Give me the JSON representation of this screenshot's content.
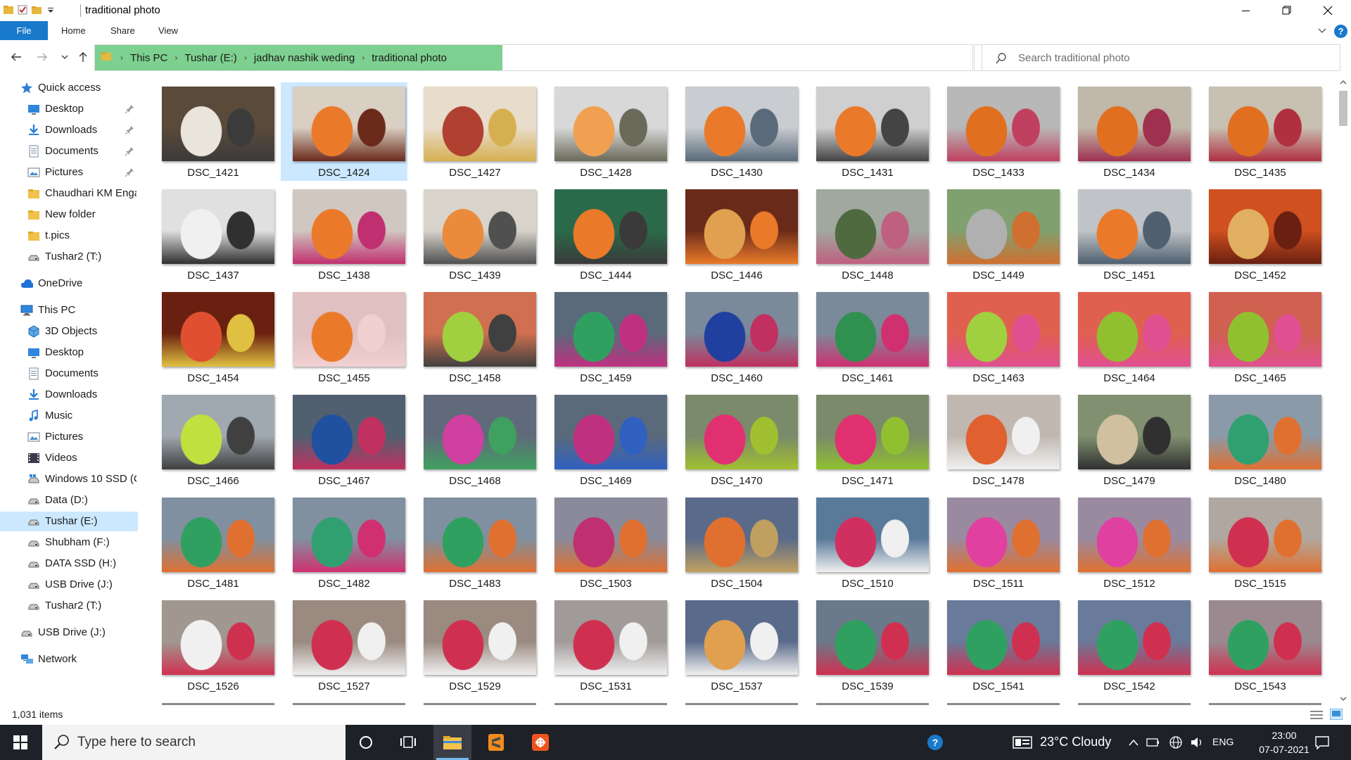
{
  "window": {
    "title": "traditional photo",
    "controls": {
      "minimize": "minimize",
      "maximize": "restore",
      "close": "close"
    }
  },
  "ribbon": {
    "tabs": [
      {
        "label": "File",
        "active": true
      },
      {
        "label": "Home"
      },
      {
        "label": "Share"
      },
      {
        "label": "View"
      }
    ]
  },
  "address": {
    "crumbs": [
      "This PC",
      "Tushar (E:)",
      "jadhav nashik weding",
      "traditional photo"
    ],
    "highlight_color": "#7dd08f"
  },
  "search": {
    "placeholder": "Search traditional photo"
  },
  "sidebar": {
    "items": [
      {
        "label": "Quick access",
        "icon": "star-icon",
        "indent": 1
      },
      {
        "label": "Desktop",
        "icon": "desktop-icon",
        "indent": 2,
        "pinned": true
      },
      {
        "label": "Downloads",
        "icon": "download-icon",
        "indent": 2,
        "pinned": true
      },
      {
        "label": "Documents",
        "icon": "document-icon",
        "indent": 2,
        "pinned": true
      },
      {
        "label": "Pictures",
        "icon": "pictures-icon",
        "indent": 2,
        "pinned": true
      },
      {
        "label": "Chaudhari KM Enga",
        "icon": "folder-icon",
        "indent": 2
      },
      {
        "label": "New folder",
        "icon": "folder-icon",
        "indent": 2
      },
      {
        "label": "t.pics",
        "icon": "folder-icon",
        "indent": 2
      },
      {
        "label": "Tushar2 (T:)",
        "icon": "drive-icon",
        "indent": 2
      },
      {
        "label": "OneDrive",
        "icon": "cloud-icon",
        "indent": 1,
        "gap": true
      },
      {
        "label": "This PC",
        "icon": "pc-icon",
        "indent": 1,
        "gap": true
      },
      {
        "label": "3D Objects",
        "icon": "cube-icon",
        "indent": 2
      },
      {
        "label": "Desktop",
        "icon": "desktop-icon",
        "indent": 2
      },
      {
        "label": "Documents",
        "icon": "document-icon",
        "indent": 2
      },
      {
        "label": "Downloads",
        "icon": "download-icon",
        "indent": 2
      },
      {
        "label": "Music",
        "icon": "music-icon",
        "indent": 2
      },
      {
        "label": "Pictures",
        "icon": "pictures-icon",
        "indent": 2
      },
      {
        "label": "Videos",
        "icon": "video-icon",
        "indent": 2
      },
      {
        "label": "Windows 10 SSD (C",
        "icon": "windows-drive-icon",
        "indent": 2
      },
      {
        "label": "Data (D:)",
        "icon": "drive-icon",
        "indent": 2
      },
      {
        "label": "Tushar (E:)",
        "icon": "drive-icon",
        "indent": 2,
        "selected": true
      },
      {
        "label": "Shubham (F:)",
        "icon": "drive-icon",
        "indent": 2
      },
      {
        "label": "DATA SSD (H:)",
        "icon": "drive-icon",
        "indent": 2
      },
      {
        "label": "USB Drive (J:)",
        "icon": "drive-icon",
        "indent": 2
      },
      {
        "label": "Tushar2 (T:)",
        "icon": "drive-icon",
        "indent": 2
      },
      {
        "label": "USB Drive (J:)",
        "icon": "drive-icon",
        "indent": 1,
        "gap": true
      },
      {
        "label": "Network",
        "icon": "network-icon",
        "indent": 1,
        "gap": true
      }
    ]
  },
  "files": [
    {
      "name": "DSC_1421",
      "colors": [
        "#5a4a3a",
        "#e9e4dc",
        "#3b3b3b"
      ]
    },
    {
      "name": "DSC_1424",
      "colors": [
        "#d9cfc2",
        "#ea7a2a",
        "#6b2a1a"
      ],
      "selected": true
    },
    {
      "name": "DSC_1427",
      "colors": [
        "#e8dccb",
        "#b04030",
        "#d6b050"
      ]
    },
    {
      "name": "DSC_1428",
      "colors": [
        "#d8d8d8",
        "#f0a050",
        "#6a6a5a"
      ]
    },
    {
      "name": "DSC_1430",
      "colors": [
        "#c9ccd0",
        "#ea7a2a",
        "#5a6a7a"
      ]
    },
    {
      "name": "DSC_1431",
      "colors": [
        "#d0cfcf",
        "#ea7a2a",
        "#444444"
      ]
    },
    {
      "name": "DSC_1433",
      "colors": [
        "#b8b8b8",
        "#e07020",
        "#c04060"
      ]
    },
    {
      "name": "DSC_1434",
      "colors": [
        "#c0b8a8",
        "#e07020",
        "#a03050"
      ]
    },
    {
      "name": "DSC_1435",
      "colors": [
        "#c8c0b0",
        "#e07020",
        "#b03040"
      ]
    },
    {
      "name": "DSC_1437",
      "colors": [
        "#e0e0e0",
        "#f0f0f0",
        "#303030"
      ]
    },
    {
      "name": "DSC_1438",
      "colors": [
        "#d0c8c0",
        "#ea7a2a",
        "#c03070"
      ]
    },
    {
      "name": "DSC_1439",
      "colors": [
        "#d8d4cc",
        "#ea8a3a",
        "#505050"
      ]
    },
    {
      "name": "DSC_1444",
      "colors": [
        "#2a6a4a",
        "#ea7a2a",
        "#3a3a3a"
      ]
    },
    {
      "name": "DSC_1446",
      "colors": [
        "#6a2a1a",
        "#e0a050",
        "#ea7a2a"
      ]
    },
    {
      "name": "DSC_1448",
      "colors": [
        "#a0a8a0",
        "#506a40",
        "#c06080"
      ]
    },
    {
      "name": "DSC_1449",
      "colors": [
        "#80a070",
        "#b0b0b0",
        "#d07030"
      ]
    },
    {
      "name": "DSC_1451",
      "colors": [
        "#c0c4c8",
        "#ea7a2a",
        "#506070"
      ]
    },
    {
      "name": "DSC_1452",
      "colors": [
        "#d05020",
        "#e0b060",
        "#6a2010"
      ]
    },
    {
      "name": "DSC_1454",
      "colors": [
        "#6a2010",
        "#e05030",
        "#e0c040"
      ]
    },
    {
      "name": "DSC_1455",
      "colors": [
        "#e0c0c0",
        "#ea7a2a",
        "#f0d0d0"
      ]
    },
    {
      "name": "DSC_1458",
      "colors": [
        "#d07050",
        "#a0d040",
        "#404040"
      ]
    },
    {
      "name": "DSC_1459",
      "colors": [
        "#5a6a7a",
        "#30a060",
        "#c03080"
      ]
    },
    {
      "name": "DSC_1460",
      "colors": [
        "#7a8a9a",
        "#2040a0",
        "#c03060"
      ]
    },
    {
      "name": "DSC_1461",
      "colors": [
        "#7a8a9a",
        "#309050",
        "#d03070"
      ]
    },
    {
      "name": "DSC_1463",
      "colors": [
        "#e06050",
        "#a0d040",
        "#e05090"
      ]
    },
    {
      "name": "DSC_1464",
      "colors": [
        "#e06050",
        "#90c030",
        "#e05090"
      ]
    },
    {
      "name": "DSC_1465",
      "colors": [
        "#d06050",
        "#90c030",
        "#e05090"
      ]
    },
    {
      "name": "DSC_1466",
      "colors": [
        "#a0a8b0",
        "#c0e040",
        "#404040"
      ]
    },
    {
      "name": "DSC_1467",
      "colors": [
        "#506070",
        "#2050a0",
        "#c03060"
      ]
    },
    {
      "name": "DSC_1468",
      "colors": [
        "#606a7a",
        "#d040a0",
        "#40a060"
      ]
    },
    {
      "name": "DSC_1469",
      "colors": [
        "#5a6a7a",
        "#c03080",
        "#3060c0"
      ]
    },
    {
      "name": "DSC_1470",
      "colors": [
        "#7a8a6a",
        "#e03070",
        "#a0c030"
      ]
    },
    {
      "name": "DSC_1471",
      "colors": [
        "#7a8a6a",
        "#e03070",
        "#90c030"
      ]
    },
    {
      "name": "DSC_1478",
      "colors": [
        "#c0b8b0",
        "#e06030",
        "#f0f0f0"
      ]
    },
    {
      "name": "DSC_1479",
      "colors": [
        "#809070",
        "#d0c0a0",
        "#303030"
      ]
    },
    {
      "name": "DSC_1480",
      "colors": [
        "#8a9aa8",
        "#30a070",
        "#e07030"
      ]
    },
    {
      "name": "DSC_1481",
      "colors": [
        "#8090a0",
        "#30a060",
        "#e07030"
      ]
    },
    {
      "name": "DSC_1482",
      "colors": [
        "#8090a0",
        "#30a070",
        "#d03070"
      ]
    },
    {
      "name": "DSC_1483",
      "colors": [
        "#8090a0",
        "#30a060",
        "#e07030"
      ]
    },
    {
      "name": "DSC_1503",
      "colors": [
        "#8a8a9a",
        "#c03070",
        "#e07030"
      ]
    },
    {
      "name": "DSC_1504",
      "colors": [
        "#5a6a8a",
        "#e07030",
        "#c0a060"
      ]
    },
    {
      "name": "DSC_1510",
      "colors": [
        "#5a7a9a",
        "#d03060",
        "#f0f0f0"
      ]
    },
    {
      "name": "DSC_1511",
      "colors": [
        "#9a8aa0",
        "#e040a0",
        "#e07030"
      ]
    },
    {
      "name": "DSC_1512",
      "colors": [
        "#9a8aa0",
        "#e040a0",
        "#e07030"
      ]
    },
    {
      "name": "DSC_1515",
      "colors": [
        "#b0a8a0",
        "#d03050",
        "#e07030"
      ]
    },
    {
      "name": "DSC_1526",
      "colors": [
        "#a09890",
        "#f0f0f0",
        "#d03050"
      ]
    },
    {
      "name": "DSC_1527",
      "colors": [
        "#9a8a80",
        "#d03050",
        "#f0f0f0"
      ]
    },
    {
      "name": "DSC_1529",
      "colors": [
        "#9a8a80",
        "#d03050",
        "#f0f0f0"
      ]
    },
    {
      "name": "DSC_1531",
      "colors": [
        "#a09a98",
        "#d03050",
        "#f0f0f0"
      ]
    },
    {
      "name": "DSC_1537",
      "colors": [
        "#5a6a8a",
        "#e0a050",
        "#f0f0f0"
      ]
    },
    {
      "name": "DSC_1539",
      "colors": [
        "#6a7a8a",
        "#30a060",
        "#d03050"
      ]
    },
    {
      "name": "DSC_1541",
      "colors": [
        "#6a7a9a",
        "#30a060",
        "#d03050"
      ]
    },
    {
      "name": "DSC_1542",
      "colors": [
        "#6a7a9a",
        "#30a060",
        "#d03050"
      ]
    },
    {
      "name": "DSC_1543",
      "colors": [
        "#9a8a90",
        "#30a060",
        "#d03050"
      ]
    }
  ],
  "status": {
    "item_count": "1,031 items"
  },
  "taskbar": {
    "search_placeholder": "Type here to search",
    "apps": [
      {
        "name": "cortana-button",
        "icon": "circle-icon"
      },
      {
        "name": "task-view-button",
        "icon": "task-view-icon"
      },
      {
        "name": "file-explorer-button",
        "icon": "folder-icon",
        "active": true
      },
      {
        "name": "sublime-text-button",
        "icon": "sublime-icon"
      },
      {
        "name": "app-button",
        "icon": "app-icon"
      }
    ],
    "weather": "23°C  Cloudy",
    "language": "ENG",
    "time": "23:00",
    "date": "07-07-2021"
  }
}
